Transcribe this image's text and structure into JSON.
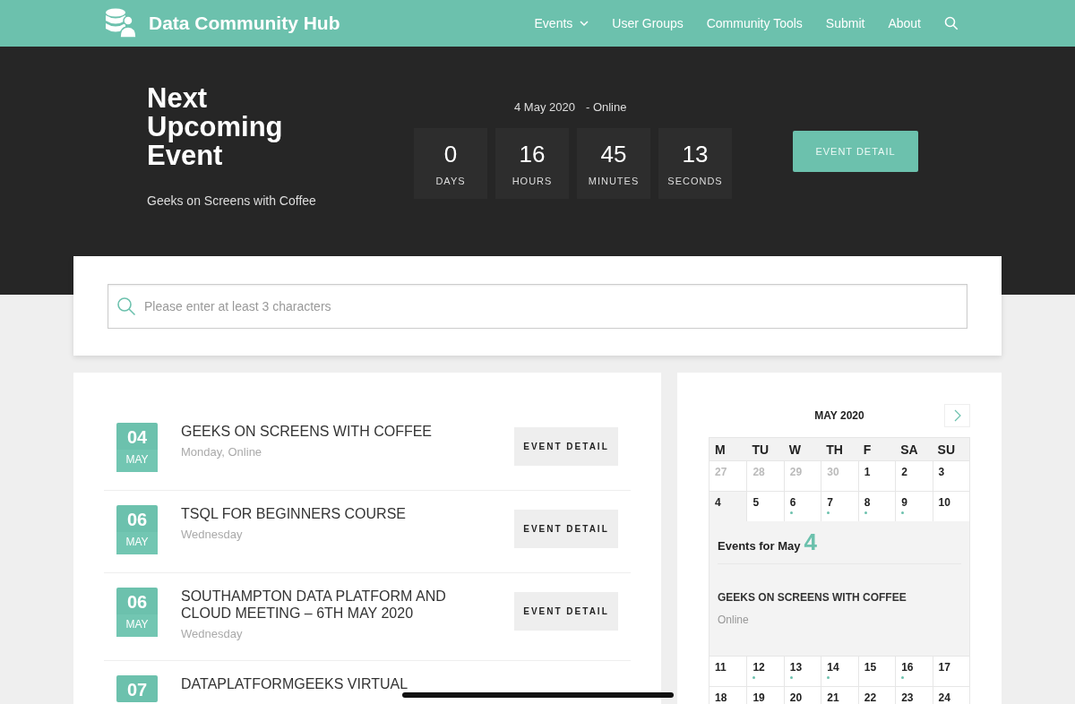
{
  "site": {
    "name": "Data Community Hub"
  },
  "nav": [
    {
      "label": "Events",
      "dropdown": true
    },
    {
      "label": "User Groups",
      "dropdown": false
    },
    {
      "label": "Community Tools",
      "dropdown": false
    },
    {
      "label": "Submit",
      "dropdown": false
    },
    {
      "label": "About",
      "dropdown": false
    }
  ],
  "hero": {
    "heading": "Next Upcoming Event",
    "event_name": "Geeks on Screens with Coffee",
    "date": "4 May 2020",
    "location": "- Online",
    "countdown": [
      {
        "value": "0",
        "unit": "DAYS"
      },
      {
        "value": "16",
        "unit": "HOURS"
      },
      {
        "value": "45",
        "unit": "MINUTES"
      },
      {
        "value": "13",
        "unit": "SECONDS"
      }
    ],
    "button": "EVENT DETAIL"
  },
  "search": {
    "placeholder": "Please enter at least 3 characters"
  },
  "events": [
    {
      "day": "04",
      "month": "MAY",
      "title": "GEEKS ON SCREENS WITH COFFEE",
      "meta": "Monday, Online",
      "button": "EVENT DETAIL"
    },
    {
      "day": "06",
      "month": "MAY",
      "title": "TSQL FOR BEGINNERS COURSE",
      "meta": "Wednesday",
      "button": "EVENT DETAIL"
    },
    {
      "day": "06",
      "month": "MAY",
      "title": "SOUTHAMPTON DATA PLATFORM AND CLOUD MEETING – 6TH MAY 2020",
      "meta": "Wednesday",
      "button": "EVENT DETAIL"
    },
    {
      "day": "07",
      "title": "DATAPLATFORMGEEKS VIRTUAL"
    }
  ],
  "calendar": {
    "title": "MAY 2020",
    "weekdays": [
      "M",
      "TU",
      "W",
      "TH",
      "F",
      "SA",
      "SU"
    ],
    "weeks": [
      {
        "days": [
          {
            "day": "27",
            "outside": true,
            "has_events": false,
            "selected": false
          },
          {
            "day": "28",
            "outside": true,
            "has_events": false,
            "selected": false
          },
          {
            "day": "29",
            "outside": true,
            "has_events": false,
            "selected": false
          },
          {
            "day": "30",
            "outside": true,
            "has_events": false,
            "selected": false
          },
          {
            "day": "1",
            "outside": false,
            "has_events": false,
            "selected": false
          },
          {
            "day": "2",
            "outside": false,
            "has_events": false,
            "selected": false
          },
          {
            "day": "3",
            "outside": false,
            "has_events": false,
            "selected": false
          }
        ]
      },
      {
        "days": [
          {
            "day": "4",
            "outside": false,
            "has_events": false,
            "selected": true
          },
          {
            "day": "5",
            "outside": false,
            "has_events": false,
            "selected": false
          },
          {
            "day": "6",
            "outside": false,
            "has_events": true,
            "selected": false
          },
          {
            "day": "7",
            "outside": false,
            "has_events": true,
            "selected": false
          },
          {
            "day": "8",
            "outside": false,
            "has_events": true,
            "selected": false
          },
          {
            "day": "9",
            "outside": false,
            "has_events": true,
            "selected": false
          },
          {
            "day": "10",
            "outside": false,
            "has_events": false,
            "selected": false
          }
        ],
        "panel": {
          "label": "Events for May",
          "day": "4",
          "event_title": "GEEKS ON SCREENS WITH COFFEE",
          "event_location": "Online"
        }
      },
      {
        "days": [
          {
            "day": "11",
            "outside": false,
            "has_events": false,
            "selected": false
          },
          {
            "day": "12",
            "outside": false,
            "has_events": true,
            "selected": false
          },
          {
            "day": "13",
            "outside": false,
            "has_events": true,
            "selected": false
          },
          {
            "day": "14",
            "outside": false,
            "has_events": true,
            "selected": false
          },
          {
            "day": "15",
            "outside": false,
            "has_events": false,
            "selected": false
          },
          {
            "day": "16",
            "outside": false,
            "has_events": true,
            "selected": false
          },
          {
            "day": "17",
            "outside": false,
            "has_events": false,
            "selected": false
          }
        ]
      },
      {
        "days": [
          {
            "day": "18",
            "outside": false,
            "has_events": false,
            "selected": false
          },
          {
            "day": "19",
            "outside": false,
            "has_events": false,
            "selected": false
          },
          {
            "day": "20",
            "outside": false,
            "has_events": false,
            "selected": false
          },
          {
            "day": "21",
            "outside": false,
            "has_events": false,
            "selected": false
          },
          {
            "day": "22",
            "outside": false,
            "has_events": false,
            "selected": false
          },
          {
            "day": "23",
            "outside": false,
            "has_events": false,
            "selected": false
          },
          {
            "day": "24",
            "outside": false,
            "has_events": false,
            "selected": false
          }
        ]
      }
    ]
  }
}
